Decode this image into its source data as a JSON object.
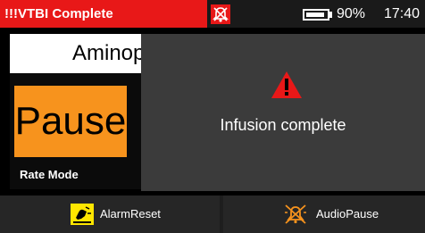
{
  "status": {
    "alarm_title": "!!!VTBI Complete",
    "alarm_off_icon": "alarm-off-icon",
    "battery_percent": 90,
    "battery_label": "90%",
    "time": "17:40",
    "colors": {
      "alarm": "#e81818",
      "bar": "#1a1a1a"
    }
  },
  "main": {
    "drug_name": "Aminop",
    "pause_label": "Pause",
    "rate_mode_label": "Rate Mode",
    "pause_color": "#f7931d"
  },
  "dialog": {
    "icon": "warning-icon",
    "message": "Infusion complete",
    "icon_color": "#e81818"
  },
  "footer": {
    "alarm_reset_label": "AlarmReset",
    "audio_pause_label": "AudioPause",
    "alarm_reset_icon": "alarm-reset-icon",
    "audio_pause_icon": "audio-pause-icon",
    "alarm_reset_icon_color": "#ffe600",
    "audio_pause_icon_color": "#f7931d"
  }
}
